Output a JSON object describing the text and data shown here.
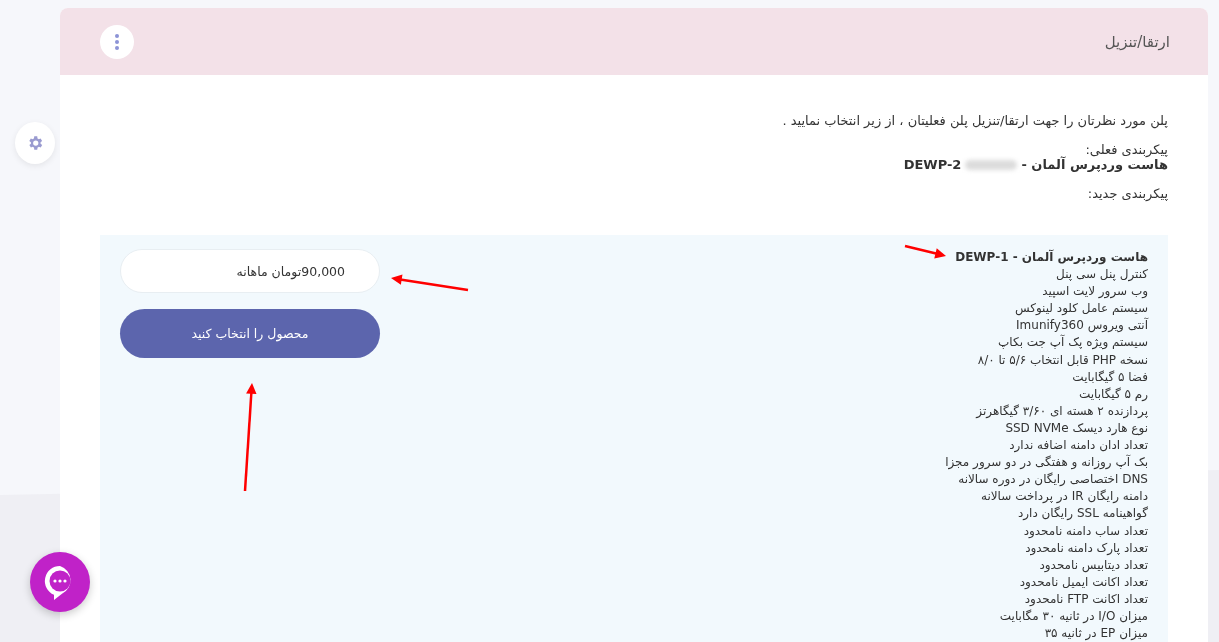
{
  "header": {
    "title": "ارتقا/تنزیل"
  },
  "intro": "پلن مورد نظرتان را جهت ارتقا/تنزیل پلن فعلیتان ، از زیر انتخاب نمایید .",
  "current_label": "پیکربندی فعلی:",
  "current_plan": {
    "name": "هاست وردپرس آلمان -",
    "code": "DEWP-2"
  },
  "new_label": "پیکربندی جدید:",
  "plans": [
    {
      "title": "هاست وردپرس آلمان - DEWP-1",
      "price": "90,000تومان ماهانه",
      "button": "محصول را انتخاب کنید",
      "features": [
        "کنترل پنل سی پنل",
        "وب سرور لایت اسپید",
        "سیستم عامل کلود لینوکس",
        "آنتی ویروس Imunify360",
        "سیستم ویژه پک آپ جت بکاپ",
        "نسخه PHP قابل انتخاب ۵/۶ تا ۸/۰",
        "فضا ۵ گیگابایت",
        "رم ۵ گیگابایت",
        "پردازنده ۲ هسته ای ۳/۶۰ گیگاهرتز",
        "نوع هارد دیسک SSD NVMe",
        "تعداد ادان دامنه اضافه ندارد",
        "بک آپ روزانه و هفتگی در دو سرور مجزا",
        "DNS اختصاصی رایگان در دوره سالانه",
        "دامنه رایگان IR در پرداخت سالانه",
        "گواهینامه SSL رایگان دارد",
        "تعداد ساب دامنه نامحدود",
        "تعداد پارک دامنه نامحدود",
        "تعداد دیتابیس نامحدود",
        "تعداد اکانت ایمیل نامحدود",
        "تعداد اکانت FTP نامحدود",
        "میزان I/O در ثانیه ۳۰ مگابایت",
        "میزان EP در ثانیه ۳۵"
      ]
    }
  ]
}
